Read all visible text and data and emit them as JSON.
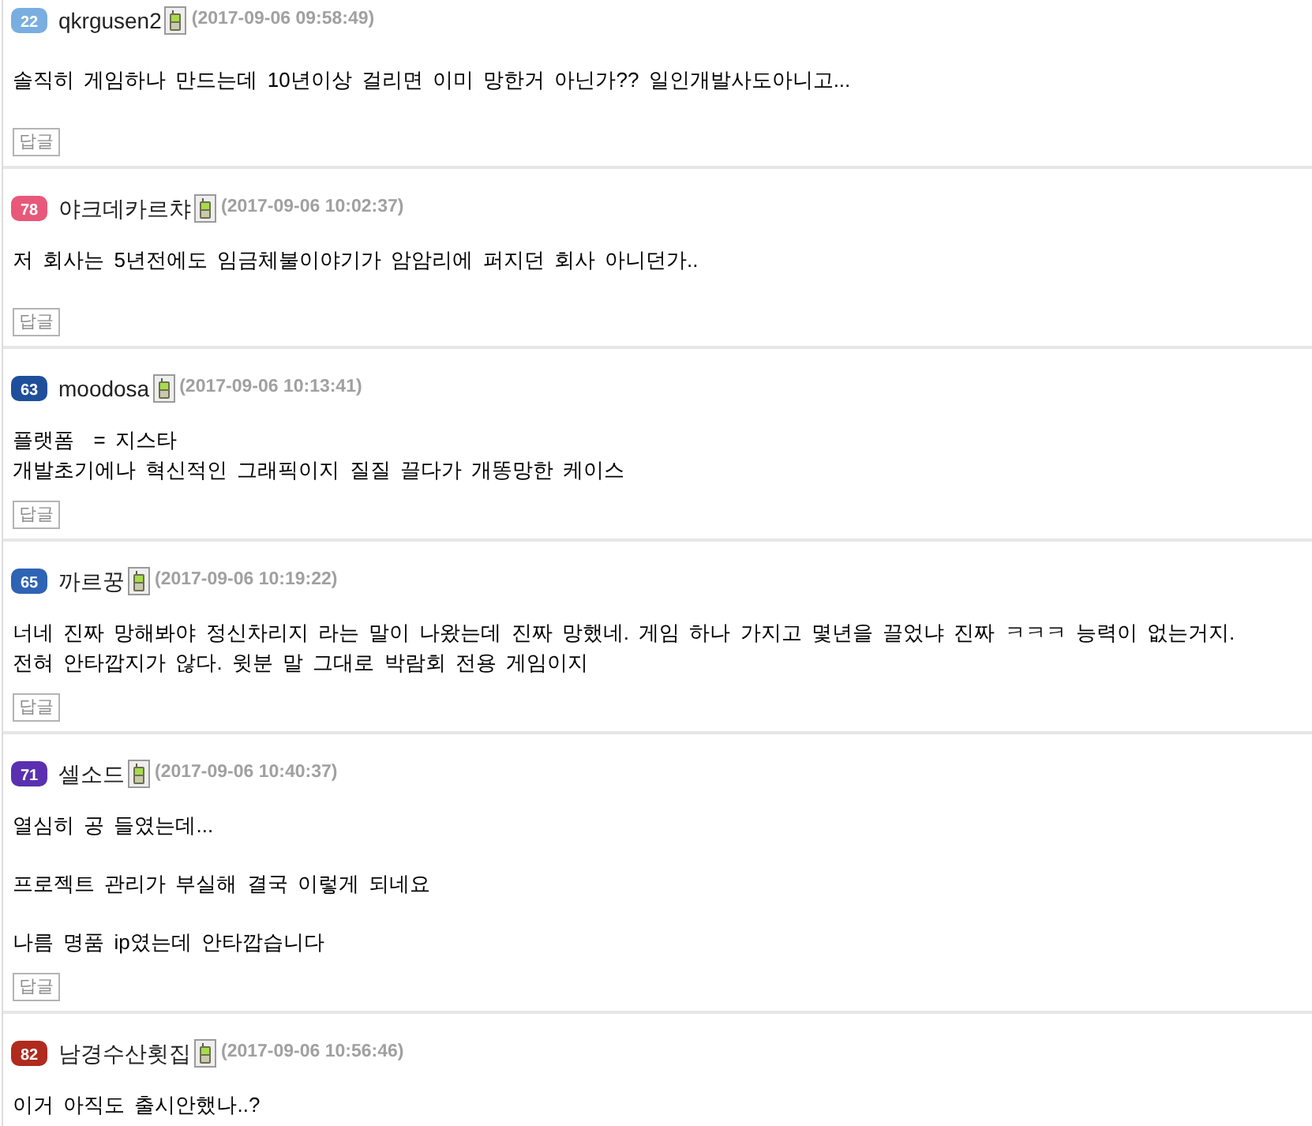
{
  "comments": [
    {
      "level": "22",
      "color": "#7aaee0",
      "username": "qkrgusen2",
      "mobile": true,
      "timestamp": "(2017-09-06 09:58:49)",
      "paragraphs": [
        [
          "솔직히 게임하나 만드는데 10년이상 걸리면 이미 망한거 아닌가?? 일인개발사도아니고..."
        ]
      ],
      "reply_label": "답글"
    },
    {
      "level": "78",
      "color": "#e8587a",
      "username": "야크데카르챠",
      "mobile": true,
      "timestamp": "(2017-09-06 10:02:37)",
      "paragraphs": [
        [
          "저 회사는 5년전에도 임금체불이야기가 암암리에 퍼지던 회사 아니던가.."
        ]
      ],
      "reply_label": "답글"
    },
    {
      "level": "63",
      "color": "#1f4f9a",
      "username": "moodosa",
      "mobile": true,
      "timestamp": "(2017-09-06 10:13:41)",
      "paragraphs": [
        [
          "플랫폼  = 지스타",
          "개발초기에나 혁신적인 그래픽이지 질질 끌다가 개똥망한 케이스"
        ]
      ],
      "reply_label": "답글"
    },
    {
      "level": "65",
      "color": "#2e63b5",
      "username": "까르꿍",
      "mobile": true,
      "timestamp": "(2017-09-06 10:19:22)",
      "paragraphs": [
        [
          "너네 진짜 망해봐야 정신차리지 라는 말이 나왔는데 진짜 망했네. 게임 하나 가지고 몇년을 끌었냐 진짜 ㅋㅋㅋ 능력이 없는거지.",
          "전혀 안타깝지가 않다. 윗분 말 그대로 박람회 전용 게임이지"
        ]
      ],
      "reply_label": "답글"
    },
    {
      "level": "71",
      "color": "#5a30b0",
      "username": "셀소드",
      "mobile": true,
      "timestamp": "(2017-09-06 10:40:37)",
      "paragraphs": [
        [
          "열심히 공 들였는데..."
        ],
        [
          "프로젝트 관리가 부실해 결국 이렇게 되네요"
        ],
        [
          "나름 명품 ip였는데 안타깝습니다"
        ]
      ],
      "reply_label": "답글"
    },
    {
      "level": "82",
      "color": "#b02a1e",
      "username": "남경수산횟집",
      "mobile": true,
      "timestamp": "(2017-09-06 10:56:46)",
      "paragraphs": [
        [
          "이거 아직도 출시안했나..?"
        ]
      ]
    }
  ]
}
